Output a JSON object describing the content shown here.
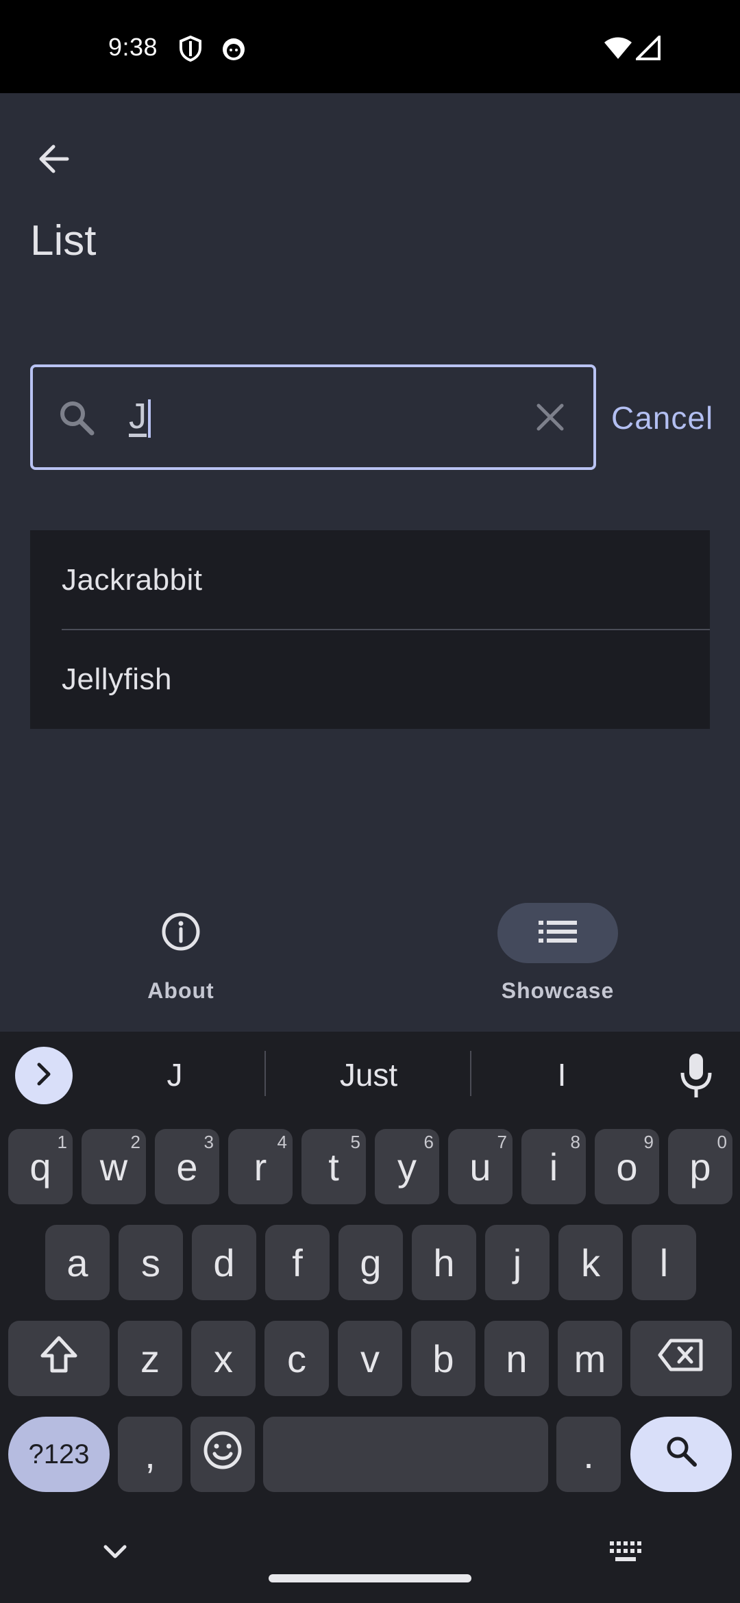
{
  "status_bar": {
    "time": "9:38",
    "icons": [
      "shield-icon",
      "cat-face-icon"
    ],
    "right_icons": [
      "wifi-icon",
      "cellular-signal-icon"
    ]
  },
  "app": {
    "title": "List",
    "back_icon": "arrow-back-icon",
    "search": {
      "value": "J",
      "icon": "search-icon",
      "clear_icon": "close-icon",
      "accent_color": "#b9c3f3"
    },
    "cancel_label": "Cancel",
    "results": [
      {
        "label": "Jackrabbit"
      },
      {
        "label": "Jellyfish"
      }
    ]
  },
  "bottom_nav": {
    "items": [
      {
        "label": "About",
        "icon": "info-icon",
        "active": false
      },
      {
        "label": "Showcase",
        "icon": "list-icon",
        "active": true
      }
    ]
  },
  "keyboard": {
    "suggestions": [
      "J",
      "Just",
      "I"
    ],
    "row1": [
      {
        "key": "q",
        "hint": "1"
      },
      {
        "key": "w",
        "hint": "2"
      },
      {
        "key": "e",
        "hint": "3"
      },
      {
        "key": "r",
        "hint": "4"
      },
      {
        "key": "t",
        "hint": "5"
      },
      {
        "key": "y",
        "hint": "6"
      },
      {
        "key": "u",
        "hint": "7"
      },
      {
        "key": "i",
        "hint": "8"
      },
      {
        "key": "o",
        "hint": "9"
      },
      {
        "key": "p",
        "hint": "0"
      }
    ],
    "row2": [
      "a",
      "s",
      "d",
      "f",
      "g",
      "h",
      "j",
      "k",
      "l"
    ],
    "row3": [
      "z",
      "x",
      "c",
      "v",
      "b",
      "n",
      "m"
    ],
    "symbols_label": "?123",
    "comma_label": ",",
    "period_label": "."
  }
}
